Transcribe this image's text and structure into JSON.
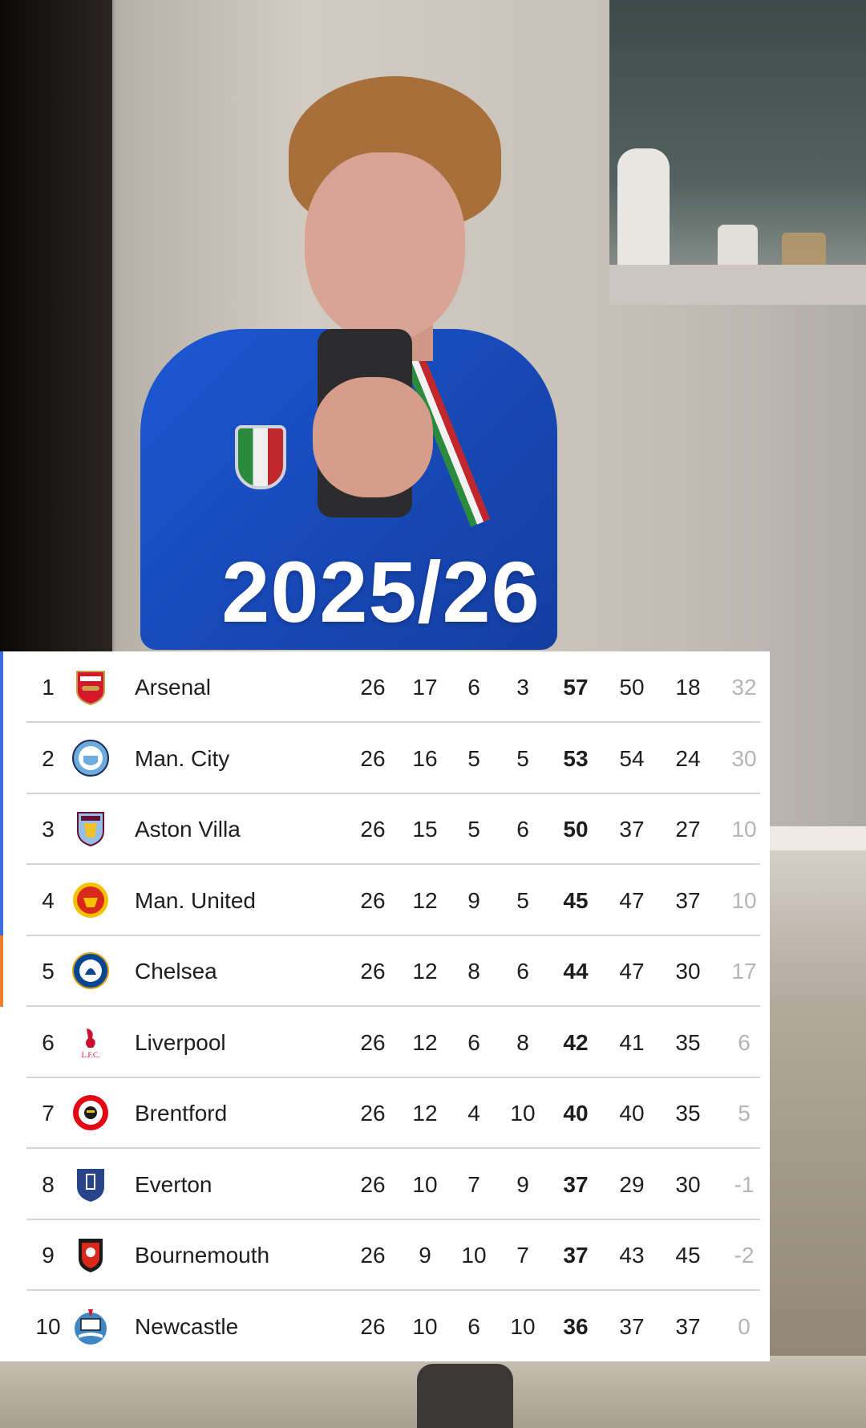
{
  "overlay": {
    "season_label": "2025/26"
  },
  "table": {
    "rows": [
      {
        "pos": "1",
        "team": "Arsenal",
        "played": "26",
        "won": "17",
        "drawn": "6",
        "lost": "3",
        "points": "57",
        "gf": "50",
        "ga": "18",
        "gd": "32",
        "zone_color": "#3b6fe0",
        "crest": "arsenal-crest-icon"
      },
      {
        "pos": "2",
        "team": "Man. City",
        "played": "26",
        "won": "16",
        "drawn": "5",
        "lost": "5",
        "points": "53",
        "gf": "54",
        "ga": "24",
        "gd": "30",
        "zone_color": "#3b6fe0",
        "crest": "man-city-crest-icon"
      },
      {
        "pos": "3",
        "team": "Aston Villa",
        "played": "26",
        "won": "15",
        "drawn": "5",
        "lost": "6",
        "points": "50",
        "gf": "37",
        "ga": "27",
        "gd": "10",
        "zone_color": "#3b6fe0",
        "crest": "aston-villa-crest-icon"
      },
      {
        "pos": "4",
        "team": "Man. United",
        "played": "26",
        "won": "12",
        "drawn": "9",
        "lost": "5",
        "points": "45",
        "gf": "47",
        "ga": "37",
        "gd": "10",
        "zone_color": "#3b6fe0",
        "crest": "man-united-crest-icon"
      },
      {
        "pos": "5",
        "team": "Chelsea",
        "played": "26",
        "won": "12",
        "drawn": "8",
        "lost": "6",
        "points": "44",
        "gf": "47",
        "ga": "30",
        "gd": "17",
        "zone_color": "#f07d2a",
        "crest": "chelsea-crest-icon"
      },
      {
        "pos": "6",
        "team": "Liverpool",
        "played": "26",
        "won": "12",
        "drawn": "6",
        "lost": "8",
        "points": "42",
        "gf": "41",
        "ga": "35",
        "gd": "6",
        "zone_color": "",
        "crest": "liverpool-crest-icon"
      },
      {
        "pos": "7",
        "team": "Brentford",
        "played": "26",
        "won": "12",
        "drawn": "4",
        "lost": "10",
        "points": "40",
        "gf": "40",
        "ga": "35",
        "gd": "5",
        "zone_color": "",
        "crest": "brentford-crest-icon"
      },
      {
        "pos": "8",
        "team": "Everton",
        "played": "26",
        "won": "10",
        "drawn": "7",
        "lost": "9",
        "points": "37",
        "gf": "29",
        "ga": "30",
        "gd": "-1",
        "zone_color": "",
        "crest": "everton-crest-icon"
      },
      {
        "pos": "9",
        "team": "Bournemouth",
        "played": "26",
        "won": "9",
        "drawn": "10",
        "lost": "7",
        "points": "37",
        "gf": "43",
        "ga": "45",
        "gd": "-2",
        "zone_color": "",
        "crest": "bournemouth-crest-icon"
      },
      {
        "pos": "10",
        "team": "Newcastle",
        "played": "26",
        "won": "10",
        "drawn": "6",
        "lost": "10",
        "points": "36",
        "gf": "37",
        "ga": "37",
        "gd": "0",
        "zone_color": "",
        "crest": "newcastle-crest-icon"
      }
    ]
  }
}
